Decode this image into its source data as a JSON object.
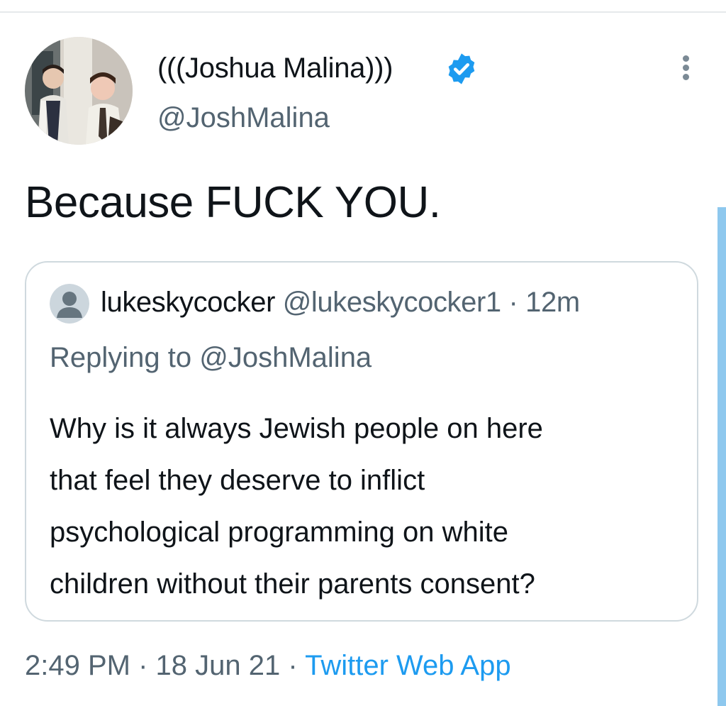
{
  "author": {
    "display_name": "(((Joshua Malina)))",
    "handle": "@JoshMalina",
    "verified": true,
    "avatar_icon": "profile-photo"
  },
  "menu": {
    "icon": "more-vertical-icon"
  },
  "tweet": {
    "text": "Because FUCK YOU."
  },
  "quoted_tweet": {
    "name": "lukeskycocker",
    "handle": "@lukeskycocker1",
    "separator": "·",
    "time_ago": "12m",
    "replying_prefix": "Replying to",
    "replying_to": "@JoshMalina",
    "lines": [
      "Why is it always Jewish people on here",
      "that feel they deserve to inflict",
      "psychological programming on white",
      "children without their parents consent?"
    ],
    "avatar_icon": "default-user-icon"
  },
  "footer": {
    "time": "2:49 PM",
    "separator": "·",
    "date": "18 Jun 21",
    "source": "Twitter Web App"
  },
  "colors": {
    "accent": "#1d9bf0",
    "text_primary": "#0f1419",
    "text_secondary": "#536471",
    "border": "#cfd9de",
    "scrollbar": "#8ec8ee"
  }
}
